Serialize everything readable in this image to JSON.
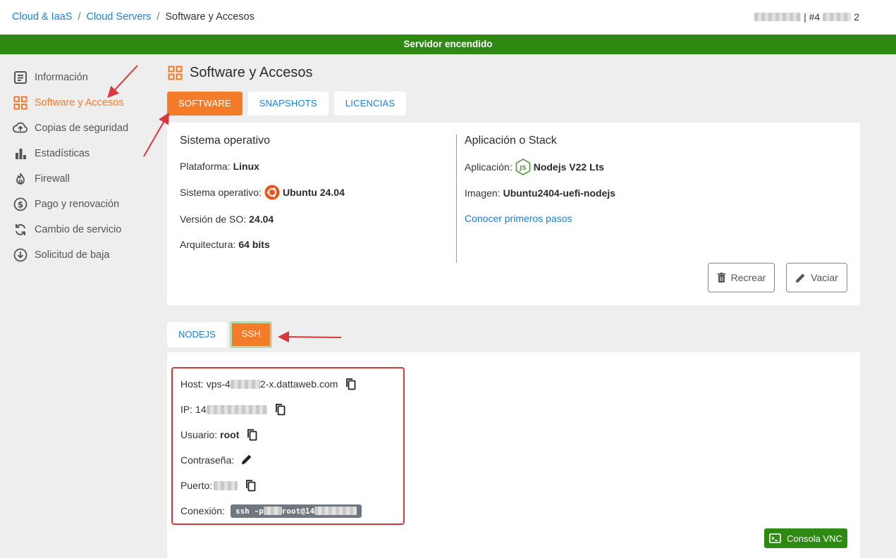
{
  "breadcrumb": {
    "items": [
      "Cloud & IaaS",
      "Cloud Servers"
    ],
    "current": "Software y Accesos"
  },
  "header": {
    "account_suffix": "| #4",
    "account_tail": "2"
  },
  "status": {
    "text": "Servidor encendido",
    "color": "#2e8a13"
  },
  "sidebar": {
    "items": [
      {
        "label": "Información",
        "icon": "document-icon"
      },
      {
        "label": "Software y Accesos",
        "icon": "grid-icon",
        "active": true
      },
      {
        "label": "Copias de seguridad",
        "icon": "cloud-upload-icon"
      },
      {
        "label": "Estadísticas",
        "icon": "bar-chart-icon"
      },
      {
        "label": "Firewall",
        "icon": "flame-icon"
      },
      {
        "label": "Pago y renovación",
        "icon": "dollar-icon"
      },
      {
        "label": "Cambio de servicio",
        "icon": "sync-icon"
      },
      {
        "label": "Solicitud de baja",
        "icon": "download-circle-icon"
      }
    ]
  },
  "page": {
    "title": "Software y Accesos"
  },
  "tabs": [
    {
      "label": "SOFTWARE",
      "active": true
    },
    {
      "label": "SNAPSHOTS"
    },
    {
      "label": "LICENCIAS"
    }
  ],
  "system": {
    "heading": "Sistema operativo",
    "platform_label": "Plataforma:",
    "platform_value": "Linux",
    "os_label": "Sistema operativo:",
    "os_value": "Ubuntu 24.04",
    "version_label": "Versión de SO:",
    "version_value": "24.04",
    "arch_label": "Arquitectura:",
    "arch_value": "64 bits"
  },
  "stack": {
    "heading": "Aplicación o Stack",
    "app_label": "Aplicación:",
    "app_value": "Nodejs V22 Lts",
    "image_label": "Imagen:",
    "image_value": "Ubuntu2404-uefi-nodejs",
    "link": "Conocer primeros pasos"
  },
  "buttons": {
    "recreate": "Recrear",
    "empty": "Vaciar",
    "vnc": "Consola VNC"
  },
  "subtabs": [
    {
      "label": "NODEJS"
    },
    {
      "label": "SSH",
      "active": true
    }
  ],
  "ssh": {
    "host_label": "Host:",
    "host_prefix": "vps-4",
    "host_suffix": "2-x.dattaweb.com",
    "ip_label": "IP:",
    "ip_prefix": "14",
    "user_label": "Usuario:",
    "user_value": "root",
    "password_label": "Contraseña:",
    "port_label": "Puerto:",
    "conn_label": "Conexión:",
    "conn_prefix": "ssh -p",
    "conn_mid": "root@14"
  },
  "colors": {
    "accent": "#f47c28",
    "link": "#1b7fd4",
    "success": "#2e8a13",
    "highlight": "#d9363e"
  }
}
